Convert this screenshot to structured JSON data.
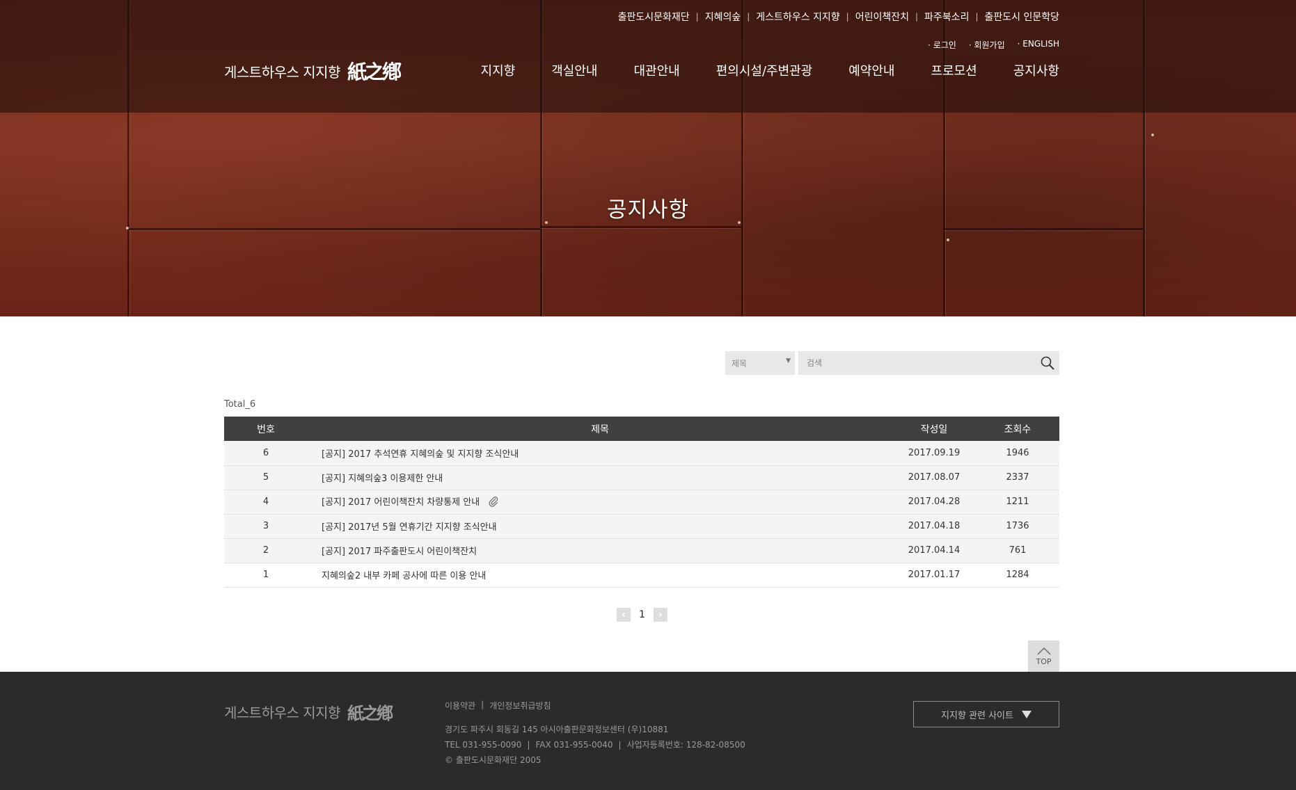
{
  "header": {
    "util_links": [
      "출판도시문화재단",
      "지혜의숲",
      "게스트하우스 지지향",
      "어린이책잔치",
      "파주북소리",
      "출판도시 인문학당"
    ],
    "account_links": [
      "로그인",
      "회원가입",
      "ENGLISH"
    ],
    "logo_text": "게스트하우스 지지향",
    "logo_mark": "紙之鄕",
    "nav": [
      "지지향",
      "객실안내",
      "대관안내",
      "편의시설/주변관광",
      "예약안내",
      "프로모션",
      "공지사항"
    ]
  },
  "hero": {
    "title": "공지사항"
  },
  "search": {
    "select_value": "제목",
    "input_placeholder": "검색"
  },
  "total_label": "Total_6",
  "table": {
    "columns": [
      "번호",
      "제목",
      "작성일",
      "조회수"
    ],
    "rows": [
      {
        "no": "6",
        "title": "[공지] 2017 추석연휴 지혜의숲 및 지지향 조식안내",
        "date": "2017.09.19",
        "views": "1946",
        "attachment": false,
        "notice": true
      },
      {
        "no": "5",
        "title": "[공지] 지혜의숲3 이용제한 안내",
        "date": "2017.08.07",
        "views": "2337",
        "attachment": false,
        "notice": true
      },
      {
        "no": "4",
        "title": "[공지] 2017 어린이책잔치 차량통제 안내",
        "date": "2017.04.28",
        "views": "1211",
        "attachment": true,
        "notice": true
      },
      {
        "no": "3",
        "title": "[공지] 2017년 5월 연휴기간 지지향 조식안내",
        "date": "2017.04.18",
        "views": "1736",
        "attachment": false,
        "notice": true
      },
      {
        "no": "2",
        "title": "[공지] 2017 파주출판도시 어린이책잔치",
        "date": "2017.04.14",
        "views": "761",
        "attachment": false,
        "notice": true
      },
      {
        "no": "1",
        "title": "지혜의숲2 내부 카페 공사에 따른 이용 안내",
        "date": "2017.01.17",
        "views": "1284",
        "attachment": false,
        "notice": false
      }
    ]
  },
  "pagination": {
    "prev": "‹",
    "current": "1",
    "next": "›"
  },
  "top_button": "TOP",
  "footer": {
    "logo_text": "게스트하우스 지지향",
    "logo_mark": "紙之鄕",
    "links": [
      "이용약관",
      "개인정보취급방침"
    ],
    "address": "경기도 파주시 회동길 145 아시아출판문화정보센터 (우)10881",
    "tel": "TEL 031-955-0090",
    "fax": "FAX 031-955-0040",
    "biz_no": "사업자등록번호: 128-82-08500",
    "copyright": "© 출판도시문화재단 2005",
    "related_sites": "지지향 관련 사이트"
  },
  "colors": {
    "hero_rust": "#7c3020",
    "table_header": "#404040",
    "footer_bg": "#2b2b2b"
  }
}
